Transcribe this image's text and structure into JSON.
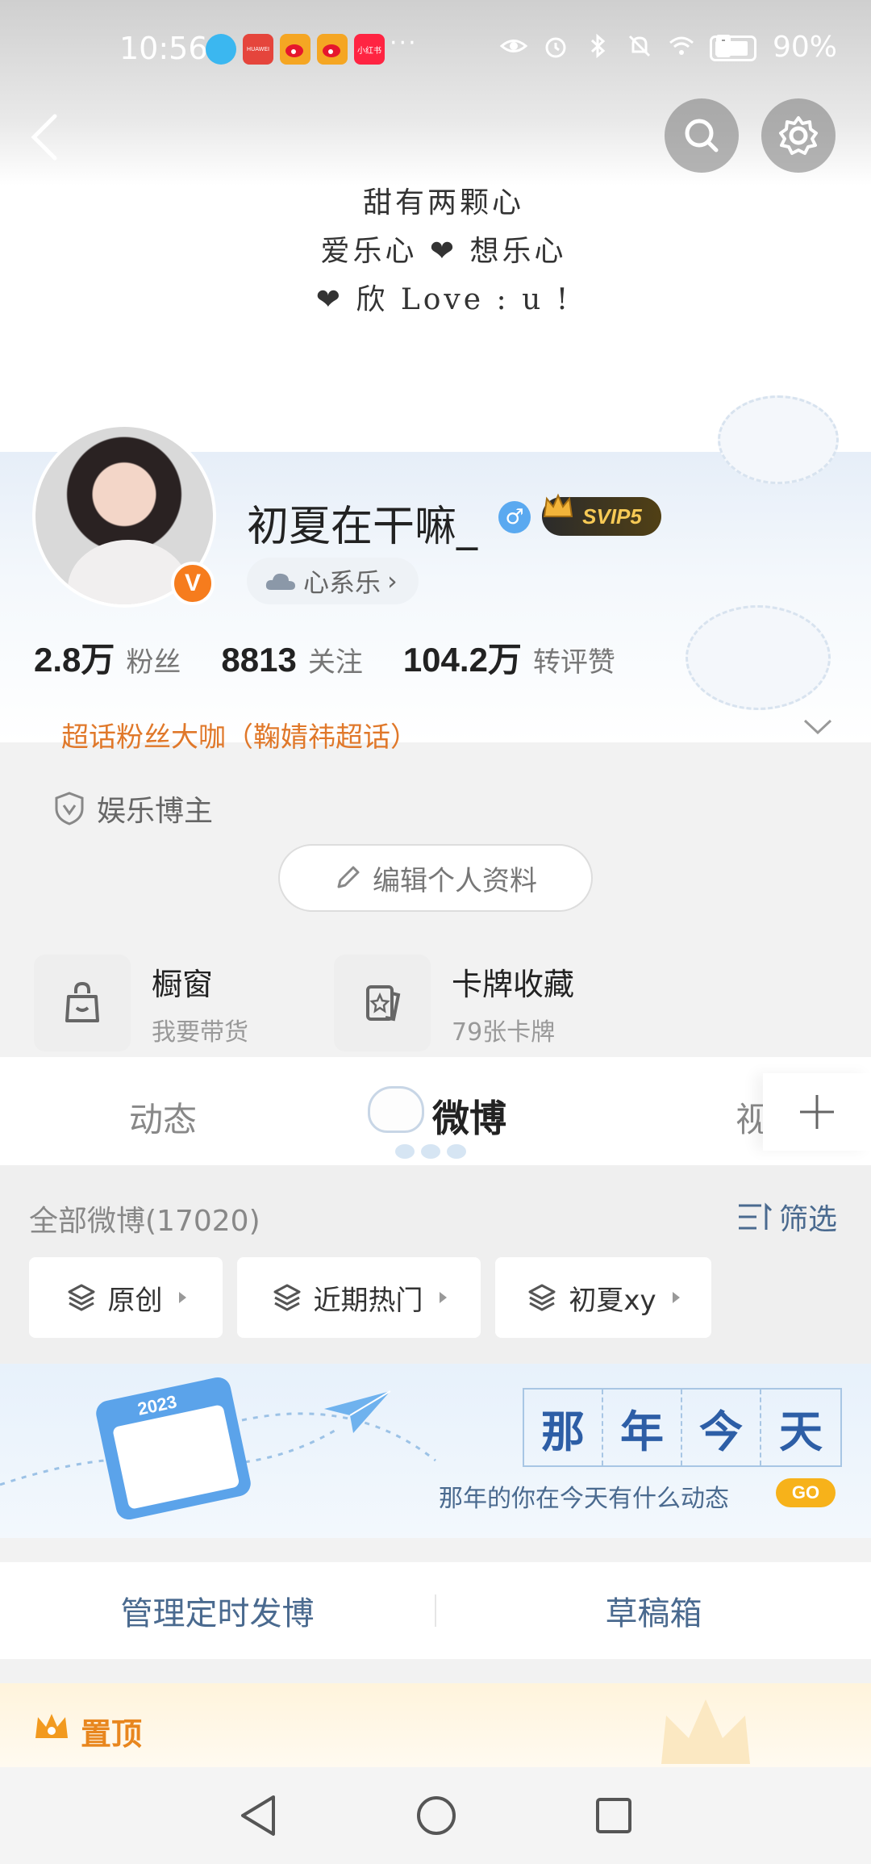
{
  "status_bar": {
    "time": "10:56",
    "notification_icons": [
      {
        "name": "app-icon",
        "color": "#3bb7f0"
      },
      {
        "name": "huawei-icon",
        "color": "#e5453c",
        "text": "HUAWEI"
      },
      {
        "name": "weibo-icon",
        "color": "#f5a623"
      },
      {
        "name": "weibo-icon",
        "color": "#f5a623"
      },
      {
        "name": "xiaohongshu-icon",
        "color": "#ff2442",
        "text": "小红书"
      }
    ],
    "more": "···",
    "battery": "90%"
  },
  "banner": {
    "handwriting": [
      "甜有两颗心",
      "爱乐心 ❤ 想乐心",
      "❤ 欣 Love : u !"
    ]
  },
  "profile": {
    "username": "初夏在干嘛_",
    "gender_symbol": "♂",
    "svip": "SVIP5",
    "verified_mark": "V",
    "group": "心系乐",
    "group_arrow": "›",
    "stats": [
      {
        "value": "2.8万",
        "label": "粉丝"
      },
      {
        "value": "8813",
        "label": "关注"
      },
      {
        "value": "104.2万",
        "label": "转评赞"
      }
    ],
    "superfan": "超话粉丝大咖（鞠婧祎超话）",
    "category": "娱乐博主",
    "edit_label": "编辑个人资料"
  },
  "features": [
    {
      "title": "橱窗",
      "subtitle": "我要带货"
    },
    {
      "title": "卡牌收藏",
      "subtitle": "79张卡牌"
    }
  ],
  "tabs": [
    "动态",
    "微博",
    "视"
  ],
  "feed": {
    "count_label": "全部微博(17020)",
    "filter_label": "筛选",
    "chips": [
      "原创",
      "近期热门",
      "初夏xy"
    ]
  },
  "memory_banner": {
    "year": "2023",
    "title_chars": [
      "那",
      "年",
      "今",
      "天"
    ],
    "subtitle": "那年的你在今天有什么动态",
    "go": "GO"
  },
  "management": [
    "管理定时发博",
    "草稿箱"
  ],
  "pinned": "置顶"
}
